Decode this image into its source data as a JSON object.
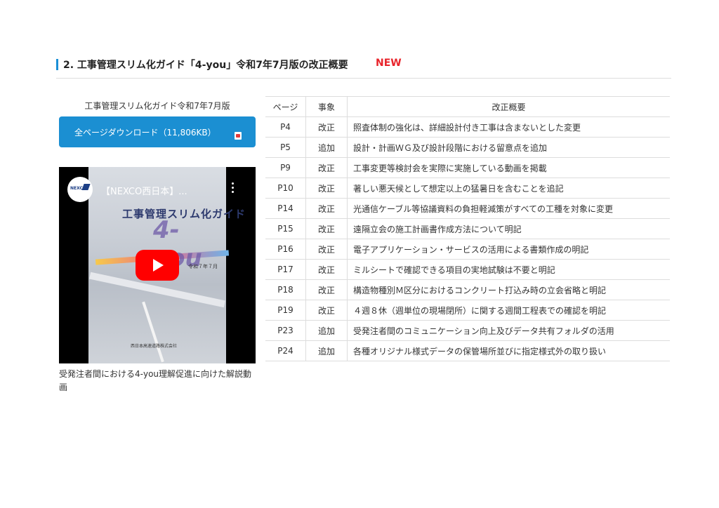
{
  "heading": {
    "title": "2. 工事管理スリム化ガイド「4-you」令和7年7月版の改正概要",
    "badge": "NEW",
    "accent_color": "#1a8fd6",
    "badge_color": "#e8242b"
  },
  "left": {
    "title": "工事管理スリム化ガイド令和7年7月版",
    "download_label": "全ページダウンロード（11,806KB）",
    "download_icon": "pdf-icon",
    "button_color": "#1b8fd2",
    "video": {
      "channel_logo_text": "NEXCO",
      "title": "【NEXCO西日本】...",
      "thumb_title": "工事管理スリム化ガイド",
      "thumb_big": "4-you",
      "thumb_date": "令和７年７月",
      "thumb_company": "西日本高速道路株式会社",
      "menu_icon": "more-vert-icon",
      "play_icon": "youtube-play-icon"
    },
    "caption": "受発注者間における4-you理解促進に向けた解説動画"
  },
  "table": {
    "headers": [
      "ページ",
      "事象",
      "改正概要"
    ],
    "rows": [
      {
        "page": "P4",
        "type": "改正",
        "desc": "照査体制の強化は、詳細設計付き工事は含まないとした変更"
      },
      {
        "page": "P5",
        "type": "追加",
        "desc": "設計・計画ＷＧ及び設計段階における留意点を追加"
      },
      {
        "page": "P9",
        "type": "改正",
        "desc": "工事変更等検討会を実際に実施している動画を掲載"
      },
      {
        "page": "P10",
        "type": "改正",
        "desc": "著しい悪天候として想定以上の猛暑日を含むことを追記"
      },
      {
        "page": "P14",
        "type": "改正",
        "desc": "光通信ケーブル等協議資料の負担軽減策がすべての工種を対象に変更"
      },
      {
        "page": "P15",
        "type": "改正",
        "desc": "遠隔立会の施工計画書作成方法について明記"
      },
      {
        "page": "P16",
        "type": "改正",
        "desc": "電子アプリケーション・サービスの活用による書類作成の明記"
      },
      {
        "page": "P17",
        "type": "改正",
        "desc": "ミルシートで確認できる項目の実地試験は不要と明記"
      },
      {
        "page": "P18",
        "type": "改正",
        "desc": "構造物種別Ｍ区分におけるコンクリート打込み時の立会省略と明記"
      },
      {
        "page": "P19",
        "type": "改正",
        "desc": "４週８休（週単位の現場閉所）に関する週間工程表での確認を明記"
      },
      {
        "page": "P23",
        "type": "追加",
        "desc": "受発注者間のコミュニケーション向上及びデータ共有フォルダの活用"
      },
      {
        "page": "P24",
        "type": "追加",
        "desc": "各種オリジナル様式データの保管場所並びに指定様式外の取り扱い"
      }
    ]
  }
}
